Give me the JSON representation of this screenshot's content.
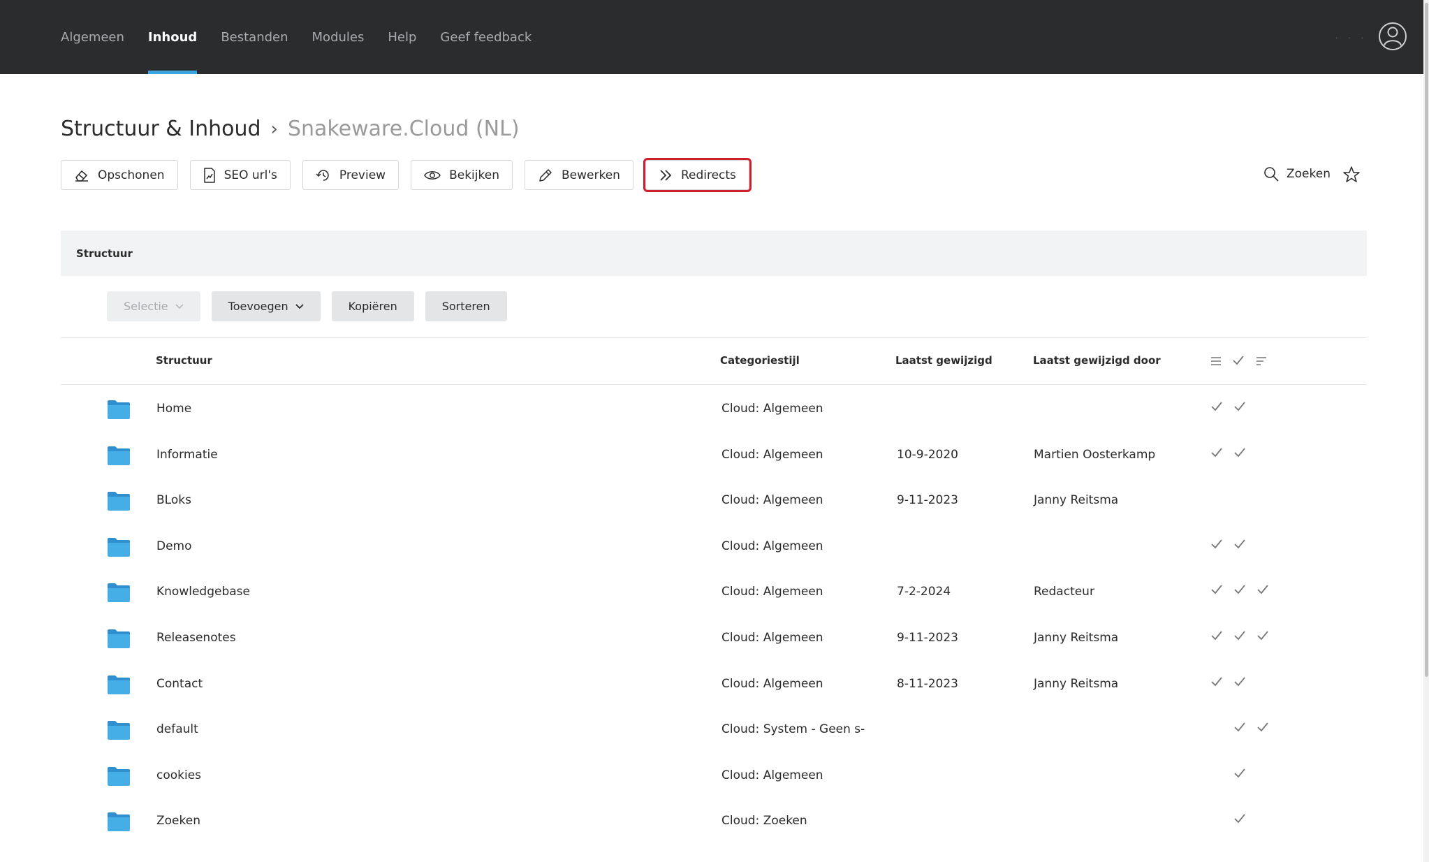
{
  "nav": {
    "items": [
      {
        "label": "Algemeen",
        "active": false
      },
      {
        "label": "Inhoud",
        "active": true
      },
      {
        "label": "Bestanden",
        "active": false
      },
      {
        "label": "Modules",
        "active": false
      },
      {
        "label": "Help",
        "active": false
      },
      {
        "label": "Geef feedback",
        "active": false
      }
    ]
  },
  "title": {
    "main": "Structuur & Inhoud",
    "separator": "›",
    "sub": "Snakeware.Cloud (NL)"
  },
  "toolbar": {
    "opschonen": "Opschonen",
    "seo": "SEO url's",
    "preview": "Preview",
    "bekijken": "Bekijken",
    "bewerken": "Bewerken",
    "redirects": "Redirects",
    "zoeken": "Zoeken"
  },
  "panel": {
    "title": "Structuur",
    "actions": {
      "selectie": "Selectie",
      "toevoegen": "Toevoegen",
      "kopieren": "Kopiëren",
      "sorteren": "Sorteren"
    }
  },
  "table": {
    "headers": {
      "structuur": "Structuur",
      "categoriestijl": "Categoriestijl",
      "laatst_gewijzigd": "Laatst gewijzigd",
      "laatst_gewijzigd_door": "Laatst gewijzigd door"
    },
    "rows": [
      {
        "name": "Home",
        "style": "Cloud: Algemeen",
        "date": "",
        "by": "",
        "checks": [
          true,
          true,
          false
        ]
      },
      {
        "name": "Informatie",
        "style": "Cloud: Algemeen",
        "date": "10-9-2020",
        "by": "Martien Oosterkamp",
        "checks": [
          true,
          true,
          false
        ]
      },
      {
        "name": "BLoks",
        "style": "Cloud: Algemeen",
        "date": "9-11-2023",
        "by": "Janny Reitsma",
        "checks": [
          false,
          false,
          false
        ]
      },
      {
        "name": "Demo",
        "style": "Cloud: Algemeen",
        "date": "",
        "by": "",
        "checks": [
          true,
          true,
          false
        ]
      },
      {
        "name": "Knowledgebase",
        "style": "Cloud: Algemeen",
        "date": "7-2-2024",
        "by": "Redacteur",
        "checks": [
          true,
          true,
          true
        ]
      },
      {
        "name": "Releasenotes",
        "style": "Cloud: Algemeen",
        "date": "9-11-2023",
        "by": "Janny Reitsma",
        "checks": [
          true,
          true,
          true
        ]
      },
      {
        "name": "Contact",
        "style": "Cloud: Algemeen",
        "date": "8-11-2023",
        "by": "Janny Reitsma",
        "checks": [
          true,
          true,
          false
        ]
      },
      {
        "name": "default",
        "style": "Cloud: System - Geen s-",
        "date": "",
        "by": "",
        "checks": [
          false,
          true,
          true
        ]
      },
      {
        "name": "cookies",
        "style": "Cloud: Algemeen",
        "date": "",
        "by": "",
        "checks": [
          false,
          true,
          false
        ]
      },
      {
        "name": "Zoeken",
        "style": "Cloud: Zoeken",
        "date": "",
        "by": "",
        "checks": [
          false,
          true,
          false
        ]
      }
    ]
  },
  "colors": {
    "topbar": "#2b2c2e",
    "accent": "#3aa4df",
    "highlight": "#d0202e",
    "folder": "#3aa4df"
  },
  "icons": {
    "opschonen": "eraser-icon",
    "seo": "document-chart-icon",
    "preview": "refresh-clock-icon",
    "bekijken": "eye-icon",
    "bewerken": "pencil-icon",
    "redirects": "double-chevron-right-icon",
    "zoeken": "search-icon",
    "favorite": "star-icon",
    "user": "user-avatar-icon",
    "folder": "folder-icon",
    "check": "check-icon"
  }
}
